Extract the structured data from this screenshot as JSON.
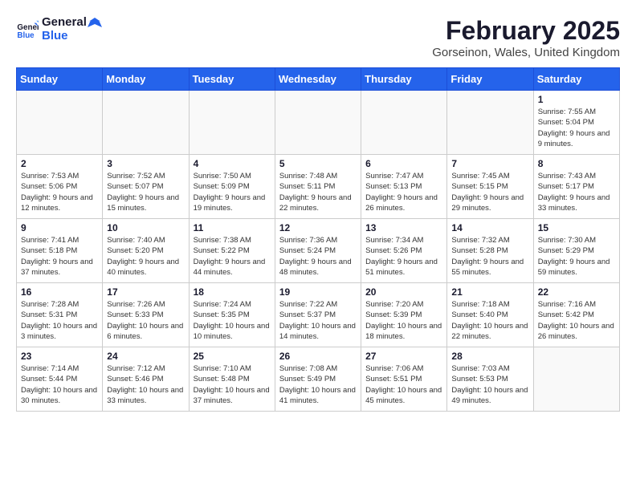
{
  "header": {
    "logo_general": "General",
    "logo_blue": "Blue",
    "month_year": "February 2025",
    "location": "Gorseinon, Wales, United Kingdom"
  },
  "weekdays": [
    "Sunday",
    "Monday",
    "Tuesday",
    "Wednesday",
    "Thursday",
    "Friday",
    "Saturday"
  ],
  "weeks": [
    [
      {
        "day": "",
        "info": ""
      },
      {
        "day": "",
        "info": ""
      },
      {
        "day": "",
        "info": ""
      },
      {
        "day": "",
        "info": ""
      },
      {
        "day": "",
        "info": ""
      },
      {
        "day": "",
        "info": ""
      },
      {
        "day": "1",
        "info": "Sunrise: 7:55 AM\nSunset: 5:04 PM\nDaylight: 9 hours and 9 minutes."
      }
    ],
    [
      {
        "day": "2",
        "info": "Sunrise: 7:53 AM\nSunset: 5:06 PM\nDaylight: 9 hours and 12 minutes."
      },
      {
        "day": "3",
        "info": "Sunrise: 7:52 AM\nSunset: 5:07 PM\nDaylight: 9 hours and 15 minutes."
      },
      {
        "day": "4",
        "info": "Sunrise: 7:50 AM\nSunset: 5:09 PM\nDaylight: 9 hours and 19 minutes."
      },
      {
        "day": "5",
        "info": "Sunrise: 7:48 AM\nSunset: 5:11 PM\nDaylight: 9 hours and 22 minutes."
      },
      {
        "day": "6",
        "info": "Sunrise: 7:47 AM\nSunset: 5:13 PM\nDaylight: 9 hours and 26 minutes."
      },
      {
        "day": "7",
        "info": "Sunrise: 7:45 AM\nSunset: 5:15 PM\nDaylight: 9 hours and 29 minutes."
      },
      {
        "day": "8",
        "info": "Sunrise: 7:43 AM\nSunset: 5:17 PM\nDaylight: 9 hours and 33 minutes."
      }
    ],
    [
      {
        "day": "9",
        "info": "Sunrise: 7:41 AM\nSunset: 5:18 PM\nDaylight: 9 hours and 37 minutes."
      },
      {
        "day": "10",
        "info": "Sunrise: 7:40 AM\nSunset: 5:20 PM\nDaylight: 9 hours and 40 minutes."
      },
      {
        "day": "11",
        "info": "Sunrise: 7:38 AM\nSunset: 5:22 PM\nDaylight: 9 hours and 44 minutes."
      },
      {
        "day": "12",
        "info": "Sunrise: 7:36 AM\nSunset: 5:24 PM\nDaylight: 9 hours and 48 minutes."
      },
      {
        "day": "13",
        "info": "Sunrise: 7:34 AM\nSunset: 5:26 PM\nDaylight: 9 hours and 51 minutes."
      },
      {
        "day": "14",
        "info": "Sunrise: 7:32 AM\nSunset: 5:28 PM\nDaylight: 9 hours and 55 minutes."
      },
      {
        "day": "15",
        "info": "Sunrise: 7:30 AM\nSunset: 5:29 PM\nDaylight: 9 hours and 59 minutes."
      }
    ],
    [
      {
        "day": "16",
        "info": "Sunrise: 7:28 AM\nSunset: 5:31 PM\nDaylight: 10 hours and 3 minutes."
      },
      {
        "day": "17",
        "info": "Sunrise: 7:26 AM\nSunset: 5:33 PM\nDaylight: 10 hours and 6 minutes."
      },
      {
        "day": "18",
        "info": "Sunrise: 7:24 AM\nSunset: 5:35 PM\nDaylight: 10 hours and 10 minutes."
      },
      {
        "day": "19",
        "info": "Sunrise: 7:22 AM\nSunset: 5:37 PM\nDaylight: 10 hours and 14 minutes."
      },
      {
        "day": "20",
        "info": "Sunrise: 7:20 AM\nSunset: 5:39 PM\nDaylight: 10 hours and 18 minutes."
      },
      {
        "day": "21",
        "info": "Sunrise: 7:18 AM\nSunset: 5:40 PM\nDaylight: 10 hours and 22 minutes."
      },
      {
        "day": "22",
        "info": "Sunrise: 7:16 AM\nSunset: 5:42 PM\nDaylight: 10 hours and 26 minutes."
      }
    ],
    [
      {
        "day": "23",
        "info": "Sunrise: 7:14 AM\nSunset: 5:44 PM\nDaylight: 10 hours and 30 minutes."
      },
      {
        "day": "24",
        "info": "Sunrise: 7:12 AM\nSunset: 5:46 PM\nDaylight: 10 hours and 33 minutes."
      },
      {
        "day": "25",
        "info": "Sunrise: 7:10 AM\nSunset: 5:48 PM\nDaylight: 10 hours and 37 minutes."
      },
      {
        "day": "26",
        "info": "Sunrise: 7:08 AM\nSunset: 5:49 PM\nDaylight: 10 hours and 41 minutes."
      },
      {
        "day": "27",
        "info": "Sunrise: 7:06 AM\nSunset: 5:51 PM\nDaylight: 10 hours and 45 minutes."
      },
      {
        "day": "28",
        "info": "Sunrise: 7:03 AM\nSunset: 5:53 PM\nDaylight: 10 hours and 49 minutes."
      },
      {
        "day": "",
        "info": ""
      }
    ]
  ]
}
